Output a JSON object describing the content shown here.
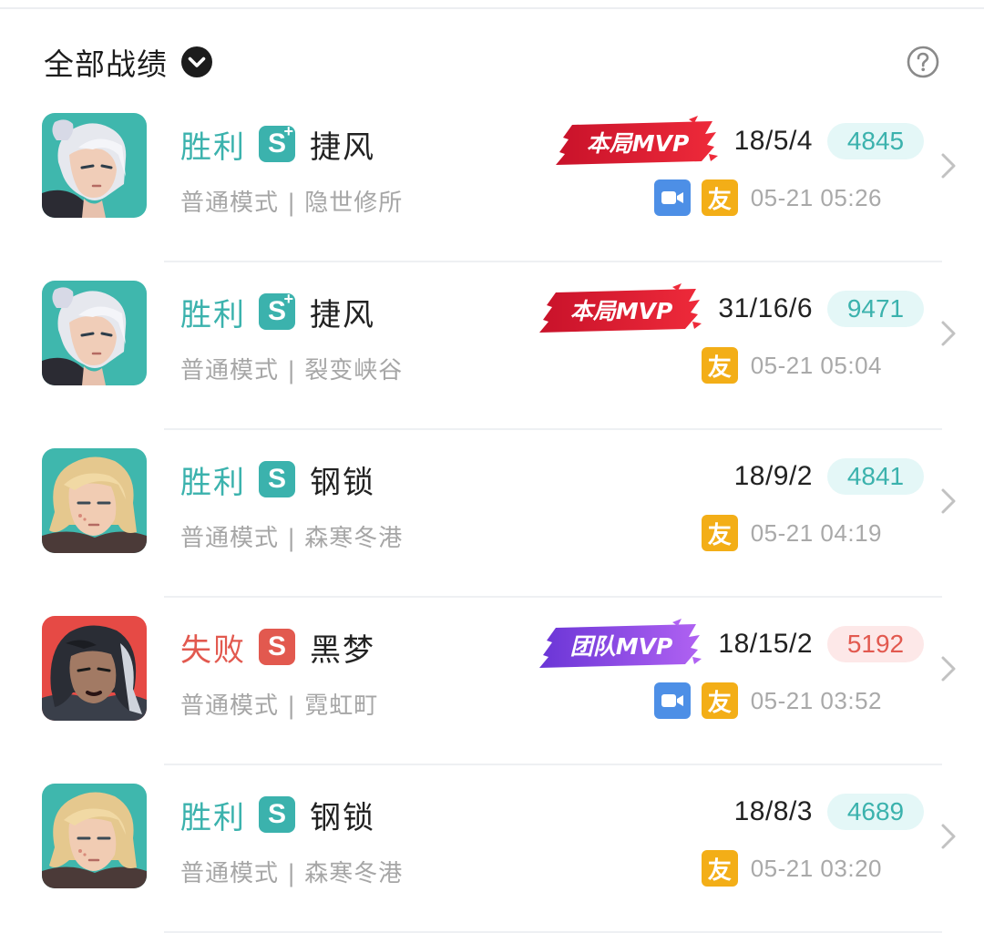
{
  "header": {
    "title": "全部战绩",
    "dropdown_icon": "chevron-down-icon",
    "help_icon": "question-icon"
  },
  "colors": {
    "win": "#3bb2ad",
    "lose": "#e2594f",
    "mvp_red": "#d7192d",
    "mvp_purple": "#8b45e8",
    "video_badge": "#4d8fe6",
    "friend_badge": "#f3ae17"
  },
  "matches": [
    {
      "result": "胜利",
      "outcome": "win",
      "grade": "S",
      "grade_plus": "+",
      "hero": "捷风",
      "mode": "普通模式 | 隐世修所",
      "mvp": "本局MVP",
      "mvp_type": "match",
      "kda": "18/5/4",
      "score": "4845",
      "video": true,
      "friend": "友",
      "time": "05-21 05:26",
      "avatar": "jett-avatar"
    },
    {
      "result": "胜利",
      "outcome": "win",
      "grade": "S",
      "grade_plus": "+",
      "hero": "捷风",
      "mode": "普通模式 | 裂变峡谷",
      "mvp": "本局MVP",
      "mvp_type": "match",
      "kda": "31/16/6",
      "score": "9471",
      "video": false,
      "friend": "友",
      "time": "05-21 05:04",
      "avatar": "jett-avatar"
    },
    {
      "result": "胜利",
      "outcome": "win",
      "grade": "S",
      "grade_plus": "",
      "hero": "钢锁",
      "mode": "普通模式 | 森寒冬港",
      "mvp": "",
      "mvp_type": "",
      "kda": "18/9/2",
      "score": "4841",
      "video": false,
      "friend": "友",
      "time": "05-21 04:19",
      "avatar": "killjoy-avatar"
    },
    {
      "result": "失败",
      "outcome": "lose",
      "grade": "S",
      "grade_plus": "",
      "hero": "黑梦",
      "mode": "普通模式 | 霓虹町",
      "mvp": "团队MVP",
      "mvp_type": "team",
      "kda": "18/15/2",
      "score": "5192",
      "video": true,
      "friend": "友",
      "time": "05-21 03:52",
      "avatar": "fade-avatar"
    },
    {
      "result": "胜利",
      "outcome": "win",
      "grade": "S",
      "grade_plus": "",
      "hero": "钢锁",
      "mode": "普通模式 | 森寒冬港",
      "mvp": "",
      "mvp_type": "",
      "kda": "18/8/3",
      "score": "4689",
      "video": false,
      "friend": "友",
      "time": "05-21 03:20",
      "avatar": "killjoy-avatar"
    }
  ]
}
